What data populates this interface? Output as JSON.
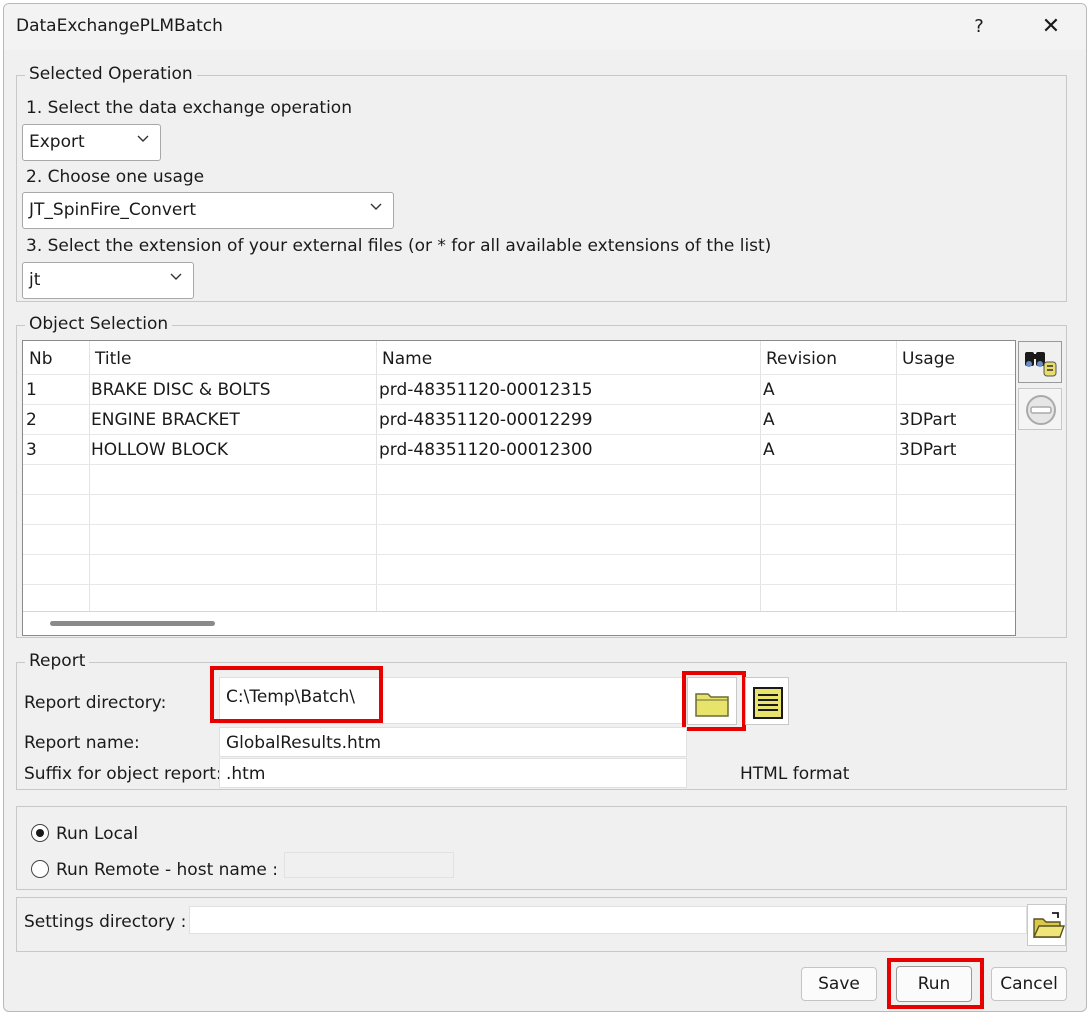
{
  "window": {
    "title": "DataExchangePLMBatch",
    "help": "?",
    "close": "✕"
  },
  "operation": {
    "legend": "Selected Operation",
    "step1": "1. Select the data exchange operation",
    "operation_value": "Export",
    "step2": "2. Choose one usage",
    "usage_value": "JT_SpinFire_Convert",
    "step3": "3. Select the extension of your external files (or * for all available extensions of the list)",
    "extension_value": "jt"
  },
  "objects": {
    "legend": "Object Selection",
    "columns": [
      "Nb",
      "Title",
      "Name",
      "Revision",
      "Usage"
    ],
    "rows": [
      [
        "1",
        "BRAKE DISC & BOLTS",
        "prd-48351120-00012315",
        "A",
        ""
      ],
      [
        "2",
        "ENGINE BRACKET",
        "prd-48351120-00012299",
        "A",
        "3DPart"
      ],
      [
        "3",
        "HOLLOW BLOCK",
        "prd-48351120-00012300",
        "A",
        "3DPart"
      ]
    ]
  },
  "report": {
    "legend": "Report",
    "dir_label": "Report directory:",
    "dir_value": "C:\\Temp\\Batch\\",
    "name_label": "Report name:",
    "name_value": "GlobalResults.htm",
    "suffix_label": "Suffix for object report:",
    "suffix_value": ".htm",
    "format": "HTML format"
  },
  "run_mode": {
    "local": "Run Local",
    "remote": "Run Remote - host name :",
    "host_value": "",
    "selected": "local"
  },
  "settings": {
    "label": "Settings directory :",
    "value": ""
  },
  "buttons": {
    "save": "Save",
    "run": "Run",
    "cancel": "Cancel"
  },
  "colors": {
    "highlight": "#e60000",
    "folder": "#e8e36a"
  }
}
